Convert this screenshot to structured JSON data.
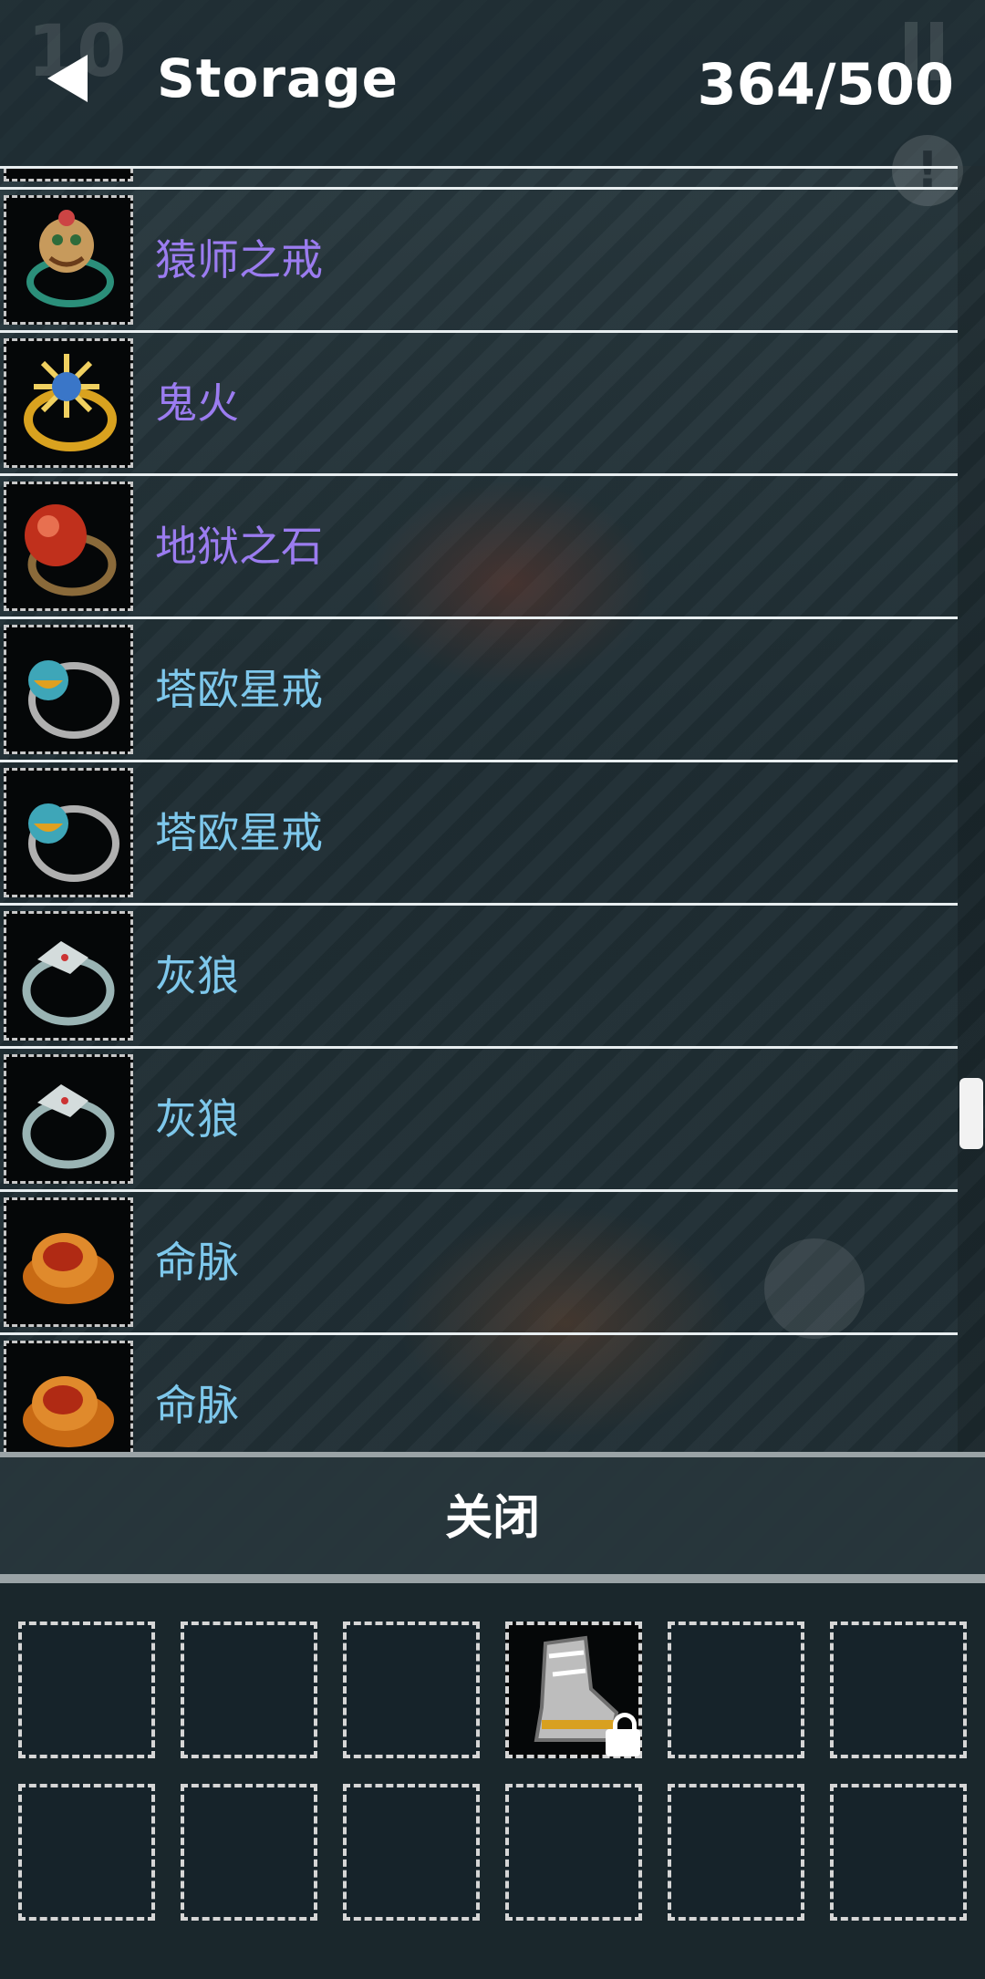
{
  "header": {
    "title": "Storage",
    "count": "364/500",
    "level_ghost": "10"
  },
  "items": [
    {
      "name": "猿师之戒",
      "color": "#9b7cf0",
      "icon": "monkey-ring-icon"
    },
    {
      "name": "鬼火",
      "color": "#9b7cf0",
      "icon": "ghost-fire-ring-icon"
    },
    {
      "name": "地狱之石",
      "color": "#9b7cf0",
      "icon": "hell-stone-ring-icon"
    },
    {
      "name": "塔欧星戒",
      "color": "#7ec8ec",
      "icon": "star-ring-icon"
    },
    {
      "name": "塔欧星戒",
      "color": "#7ec8ec",
      "icon": "star-ring-icon"
    },
    {
      "name": "灰狼",
      "color": "#7ec8ec",
      "icon": "grey-wolf-ring-icon"
    },
    {
      "name": "灰狼",
      "color": "#7ec8ec",
      "icon": "grey-wolf-ring-icon"
    },
    {
      "name": "命脉",
      "color": "#7ec8ec",
      "icon": "lifeline-ring-icon"
    },
    {
      "name": "命脉",
      "color": "#7ec8ec",
      "icon": "lifeline-ring-icon"
    }
  ],
  "close_label": "关闭",
  "inventory": {
    "slots": 12,
    "filled": [
      {
        "index": 3,
        "icon": "boots-icon",
        "locked": true
      }
    ]
  }
}
